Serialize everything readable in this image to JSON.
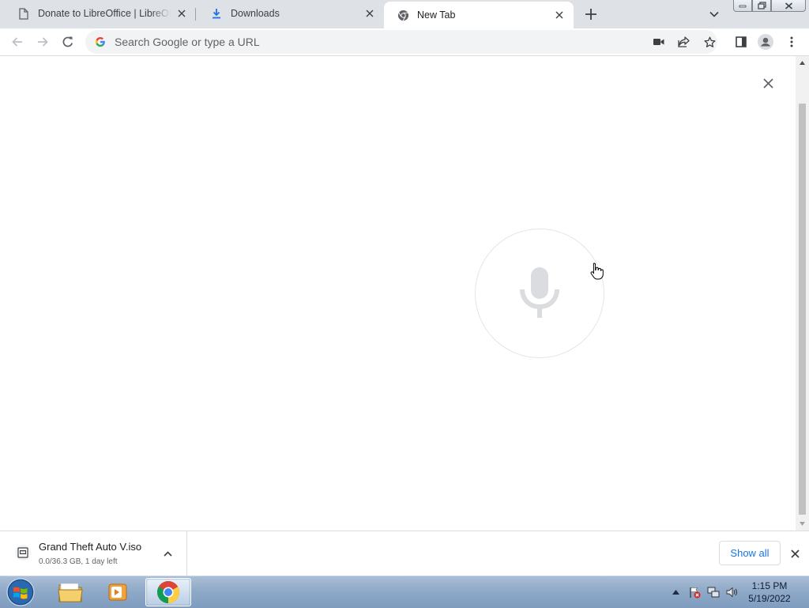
{
  "browser": {
    "tabs": [
      {
        "title": "Donate to LibreOffice | LibreOffice",
        "icon": "document-icon",
        "active": false
      },
      {
        "title": "Downloads",
        "icon": "download-icon",
        "active": false
      },
      {
        "title": "New Tab",
        "icon": "chrome-icon",
        "active": true
      }
    ],
    "omnibox": {
      "placeholder": "Search Google or type a URL",
      "value": ""
    },
    "accent": "#1a73e8"
  },
  "voice_search": {
    "state": "listening",
    "icon": "microphone-icon"
  },
  "download_shelf": {
    "file_name": "Grand Theft Auto V.iso",
    "status": "0.0/36.3 GB, 1 day left",
    "show_all_label": "Show all"
  },
  "taskbar": {
    "apps": [
      "windows-explorer",
      "media-player",
      "google-chrome"
    ],
    "active_app": "google-chrome",
    "clock": {
      "time": "1:15 PM",
      "date": "5/19/2022"
    }
  }
}
